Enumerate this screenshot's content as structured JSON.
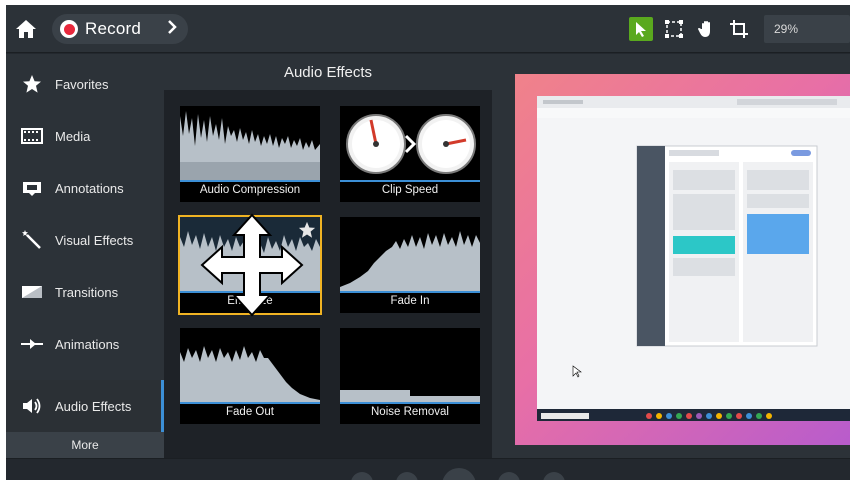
{
  "topbar": {
    "record_label": "Record",
    "zoom_value": "29%",
    "accent_color": "#5aa91e",
    "tools": [
      "pointer-icon",
      "crop-select-icon",
      "hand-icon",
      "crop-icon"
    ]
  },
  "sidebar": {
    "items": [
      {
        "label": "Favorites",
        "icon": "star-icon"
      },
      {
        "label": "Media",
        "icon": "film-icon"
      },
      {
        "label": "Annotations",
        "icon": "annotation-icon"
      },
      {
        "label": "Visual Effects",
        "icon": "wand-icon"
      },
      {
        "label": "Transitions",
        "icon": "transition-icon"
      },
      {
        "label": "Animations",
        "icon": "animation-icon"
      },
      {
        "label": "Audio Effects",
        "icon": "speaker-icon",
        "active": true
      }
    ],
    "more_label": "More",
    "active_color": "#3c8fd6"
  },
  "panel": {
    "title": "Audio Effects",
    "tiles": [
      {
        "label": "Audio Compression"
      },
      {
        "label": "Clip Speed"
      },
      {
        "label": "Emph    ze",
        "selected": true
      },
      {
        "label": "Fade In"
      },
      {
        "label": "Fade Out"
      },
      {
        "label": "Noise Removal"
      }
    ],
    "selected_color": "#f0b323"
  }
}
